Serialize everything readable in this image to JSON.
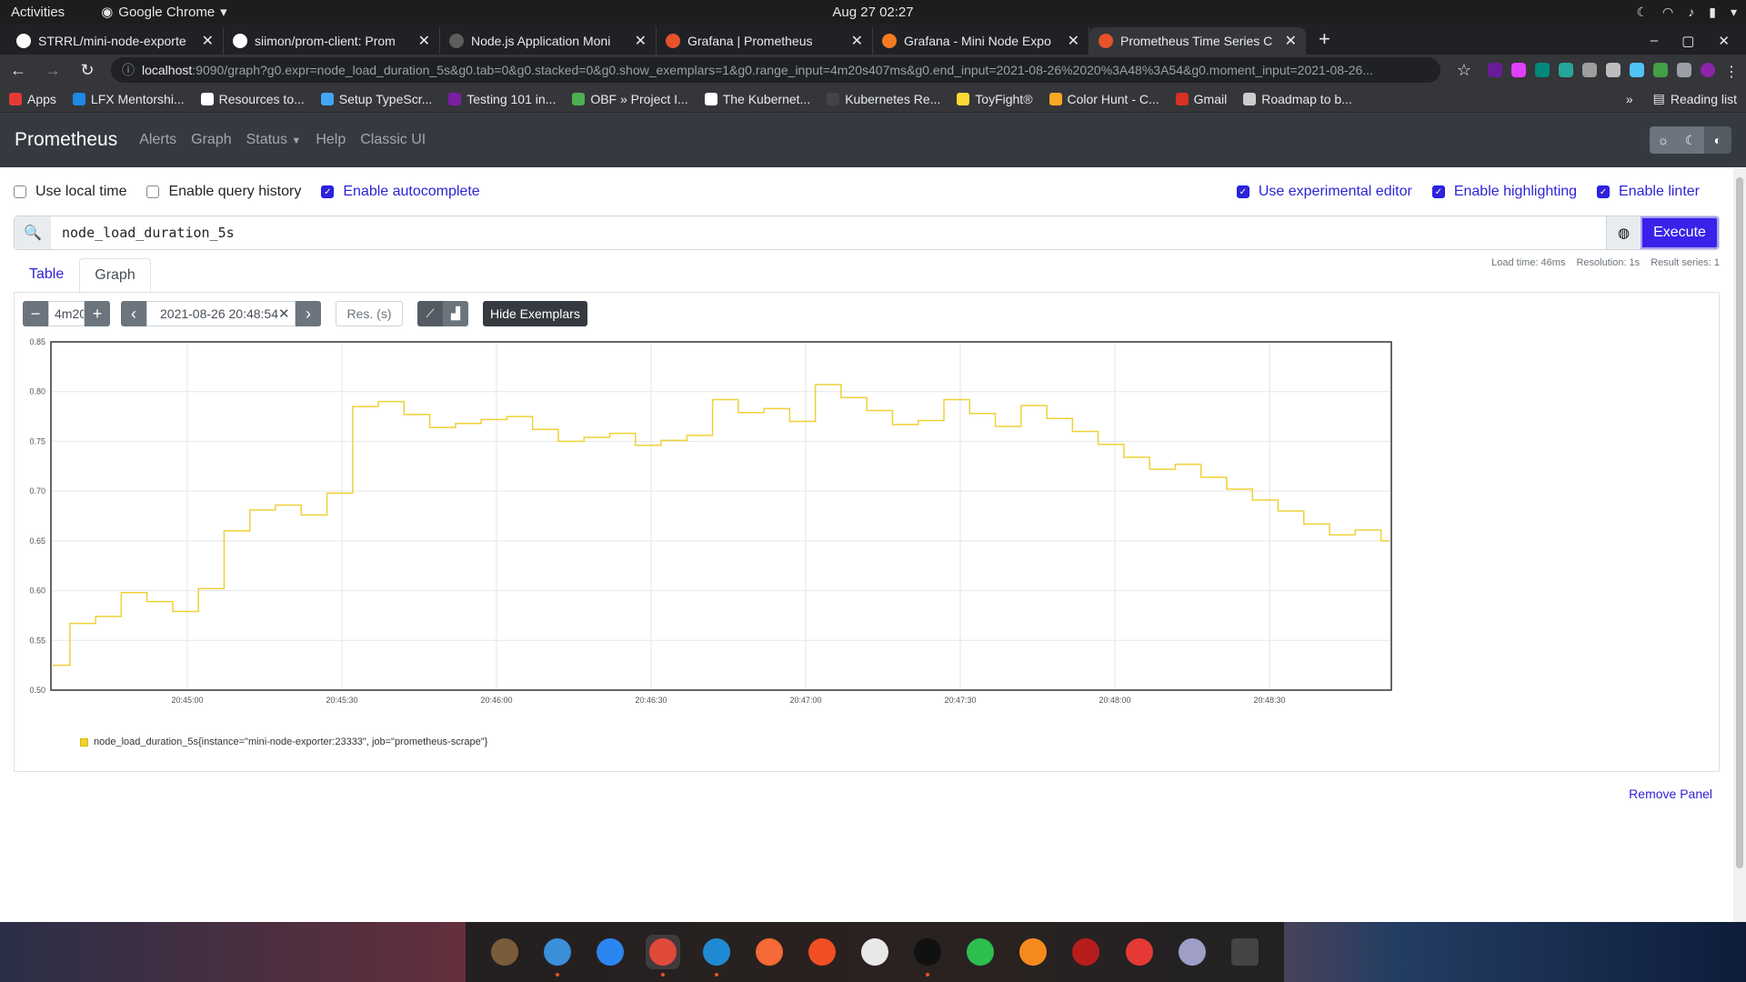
{
  "topbar": {
    "activities": "Activities",
    "app": "Google Chrome",
    "clock": "Aug 27  02:27"
  },
  "tabs": [
    {
      "title": "STRRL/mini-node-exporte",
      "color": "#ffffff"
    },
    {
      "title": "siimon/prom-client: Prom",
      "color": "#ffffff"
    },
    {
      "title": "Node.js Application Moni",
      "color": "#5d5d5d"
    },
    {
      "title": "Grafana | Prometheus",
      "color": "#e6522c"
    },
    {
      "title": "Grafana - Mini Node Expo",
      "color": "#f47a20"
    },
    {
      "title": "Prometheus Time Series C",
      "color": "#e6522c"
    }
  ],
  "omnibox": {
    "host": "localhost",
    "rest": ":9090/graph?g0.expr=node_load_duration_5s&g0.tab=0&g0.stacked=0&g0.show_exemplars=1&g0.range_input=4m20s407ms&g0.end_input=2021-08-26%2020%3A48%3A54&g0.moment_input=2021-08-26..."
  },
  "bookmarks": [
    {
      "label": "Apps",
      "color": "#e53935"
    },
    {
      "label": "LFX Mentorshi...",
      "color": "#1e88e5"
    },
    {
      "label": "Resources to...",
      "color": "#ffffff"
    },
    {
      "label": "Setup TypeScr...",
      "color": "#42a5f5"
    },
    {
      "label": "Testing 101 in...",
      "color": "#7b1fa2"
    },
    {
      "label": "OBF » Project I...",
      "color": "#4caf50"
    },
    {
      "label": "The Kubernet...",
      "color": "#ffffff"
    },
    {
      "label": "Kubernetes Re...",
      "color": "#444444"
    },
    {
      "label": "ToyFight®",
      "color": "#fdd835"
    },
    {
      "label": "Color Hunt - C...",
      "color": "#f9a825"
    },
    {
      "label": "Gmail",
      "color": "#d93025"
    },
    {
      "label": "Roadmap to b...",
      "color": "#cccccc"
    }
  ],
  "reading_list": "Reading list",
  "prom_nav": {
    "brand": "Prometheus",
    "links": [
      "Alerts",
      "Graph",
      "Status",
      "Help",
      "Classic UI"
    ]
  },
  "options_left": [
    {
      "label": "Use local time",
      "checked": false
    },
    {
      "label": "Enable query history",
      "checked": false
    },
    {
      "label": "Enable autocomplete",
      "checked": true
    }
  ],
  "options_right": [
    {
      "label": "Use experimental editor",
      "checked": true
    },
    {
      "label": "Enable highlighting",
      "checked": true
    },
    {
      "label": "Enable linter",
      "checked": true
    }
  ],
  "query": {
    "expr": "node_load_duration_5s",
    "execute": "Execute"
  },
  "panel_tabs": [
    "Table",
    "Graph"
  ],
  "stats": {
    "load": "Load time: 46ms",
    "resolution": "Resolution: 1s",
    "series": "Result series: 1"
  },
  "controls": {
    "range": "4m20",
    "end": "2021-08-26 20:48:54",
    "res_placeholder": "Res. (s)",
    "exemplars": "Hide Exemplars"
  },
  "legend": "node_load_duration_5s{instance=\"mini-node-exporter:23333\", job=\"prometheus-scrape\"}",
  "remove_panel": "Remove Panel",
  "chart_data": {
    "type": "line",
    "x_ticks": [
      "20:45:00",
      "20:45:30",
      "20:46:00",
      "20:46:30",
      "20:47:00",
      "20:47:30",
      "20:48:00",
      "20:48:30"
    ],
    "y_ticks": [
      "0.50",
      "0.55",
      "0.60",
      "0.65",
      "0.70",
      "0.75",
      "0.80",
      "0.85"
    ],
    "ylim": [
      0.5,
      0.85
    ],
    "color": "#eed138",
    "series": [
      {
        "name": "node_load_duration_5s{instance=\"mini-node-exporter:23333\", job=\"prometheus-scrape\"}",
        "values": [
          0.525,
          0.525,
          0.567,
          0.567,
          0.567,
          0.574,
          0.574,
          0.574,
          0.598,
          0.598,
          0.598,
          0.589,
          0.589,
          0.589,
          0.579,
          0.579,
          0.579,
          0.602,
          0.602,
          0.602,
          0.66,
          0.66,
          0.66,
          0.681,
          0.681,
          0.681,
          0.686,
          0.686,
          0.686,
          0.676,
          0.676,
          0.676,
          0.698,
          0.698,
          0.698,
          0.785,
          0.785,
          0.785,
          0.79,
          0.79,
          0.79,
          0.777,
          0.777,
          0.777,
          0.764,
          0.764,
          0.764,
          0.768,
          0.768,
          0.768,
          0.772,
          0.772,
          0.772,
          0.775,
          0.775,
          0.775,
          0.762,
          0.762,
          0.762,
          0.75,
          0.75,
          0.75,
          0.754,
          0.754,
          0.754,
          0.758,
          0.758,
          0.758,
          0.746,
          0.746,
          0.746,
          0.751,
          0.751,
          0.751,
          0.756,
          0.756,
          0.756,
          0.792,
          0.792,
          0.792,
          0.779,
          0.779,
          0.779,
          0.783,
          0.783,
          0.783,
          0.77,
          0.77,
          0.77,
          0.807,
          0.807,
          0.807,
          0.794,
          0.794,
          0.794,
          0.781,
          0.781,
          0.781,
          0.767,
          0.767,
          0.767,
          0.771,
          0.771,
          0.771,
          0.792,
          0.792,
          0.792,
          0.778,
          0.778,
          0.778,
          0.765,
          0.765,
          0.765,
          0.786,
          0.786,
          0.786,
          0.773,
          0.773,
          0.773,
          0.76,
          0.76,
          0.76,
          0.747,
          0.747,
          0.747,
          0.734,
          0.734,
          0.734,
          0.722,
          0.722,
          0.722,
          0.727,
          0.727,
          0.727,
          0.714,
          0.714,
          0.714,
          0.702,
          0.702,
          0.702,
          0.691,
          0.691,
          0.691,
          0.68,
          0.68,
          0.68,
          0.667,
          0.667,
          0.667,
          0.656,
          0.656,
          0.656,
          0.661,
          0.661,
          0.661,
          0.65,
          0.65
        ]
      }
    ]
  },
  "dock": [
    {
      "name": "gimp",
      "color": "#7a5c3a",
      "active": false,
      "dot": false
    },
    {
      "name": "files",
      "color": "#3b8fd9",
      "active": false,
      "dot": true
    },
    {
      "name": "app-store",
      "color": "#2b86f0",
      "active": false,
      "dot": false
    },
    {
      "name": "chrome",
      "color": "#e04a3a",
      "active": true,
      "dot": true
    },
    {
      "name": "vscode",
      "color": "#1f8ad2",
      "active": false,
      "dot": true
    },
    {
      "name": "postman",
      "color": "#f56a36",
      "active": false,
      "dot": false
    },
    {
      "name": "brave",
      "color": "#f04f23",
      "active": false,
      "dot": false
    },
    {
      "name": "slack",
      "color": "#e8e8e8",
      "active": false,
      "dot": false
    },
    {
      "name": "terminal",
      "color": "#111111",
      "active": false,
      "dot": true
    },
    {
      "name": "gitkraken",
      "color": "#2dbe4f",
      "active": false,
      "dot": false
    },
    {
      "name": "vlc",
      "color": "#f58b1f",
      "active": false,
      "dot": false
    },
    {
      "name": "video-editor",
      "color": "#b71c1c",
      "active": false,
      "dot": false
    },
    {
      "name": "downloader",
      "color": "#e53935",
      "active": false,
      "dot": false
    },
    {
      "name": "screen-recorder",
      "color": "#9e9ec6",
      "active": false,
      "dot": false
    },
    {
      "name": "app-grid",
      "color": "#444444",
      "active": false,
      "dot": false
    }
  ]
}
